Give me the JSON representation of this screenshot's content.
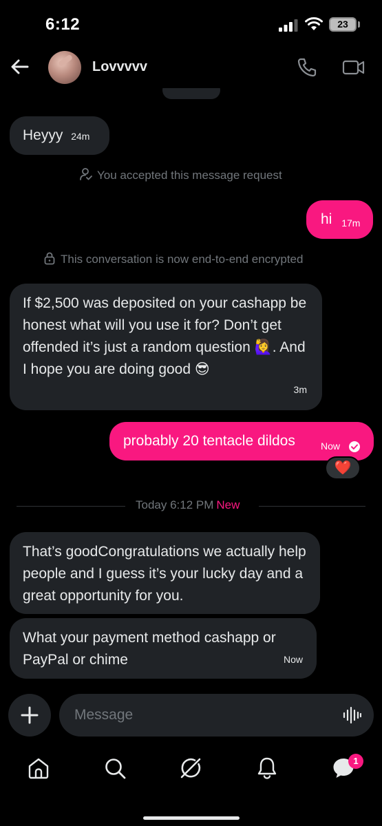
{
  "status_bar": {
    "time": "6:12",
    "battery": "23"
  },
  "header": {
    "contact_name": "Lovvvvv"
  },
  "day_separator": {
    "label": "Today"
  },
  "messages": [
    {
      "direction": "in",
      "text": "Heyyy",
      "time": "24m"
    },
    {
      "direction": "out",
      "text": "hi",
      "time": "17m"
    },
    {
      "direction": "in",
      "text": "If $2,500 was deposited on your cashapp be honest what will you use it for? Don’t get offended it’s just a random question 🙋‍♀️. And I hope you are doing good 😎",
      "time": "3m"
    },
    {
      "direction": "out",
      "text": "probably 20 tentacle dildos",
      "time": "Now",
      "status": "read"
    },
    {
      "direction": "in",
      "text": "That’s goodCongratulations  we actually help people and I guess it’s your lucky day and a great opportunity for you.",
      "time": ""
    },
    {
      "direction": "in",
      "text": "What your payment method cashapp or PayPal or chime",
      "time": "Now"
    }
  ],
  "system_notes": {
    "accepted": "You accepted this message request",
    "encrypted": "This conversation is now end-to-end encrypted"
  },
  "reaction": "❤️",
  "new_divider": {
    "label": "Today 6:12 PM",
    "new_label": "New"
  },
  "composer": {
    "placeholder": "Message"
  },
  "nav": {
    "messages_badge": "1"
  },
  "colors": {
    "accent": "#f91880",
    "incoming_bubble": "#202327",
    "muted_text": "#71767b",
    "background": "#000000"
  },
  "icons": [
    "back-arrow-icon",
    "phone-icon",
    "video-camera-icon",
    "person-check-icon",
    "lock-icon",
    "check-circle-icon",
    "plus-icon",
    "voice-waveform-icon",
    "home-icon",
    "search-icon",
    "grok-icon",
    "bell-icon",
    "messages-icon"
  ]
}
